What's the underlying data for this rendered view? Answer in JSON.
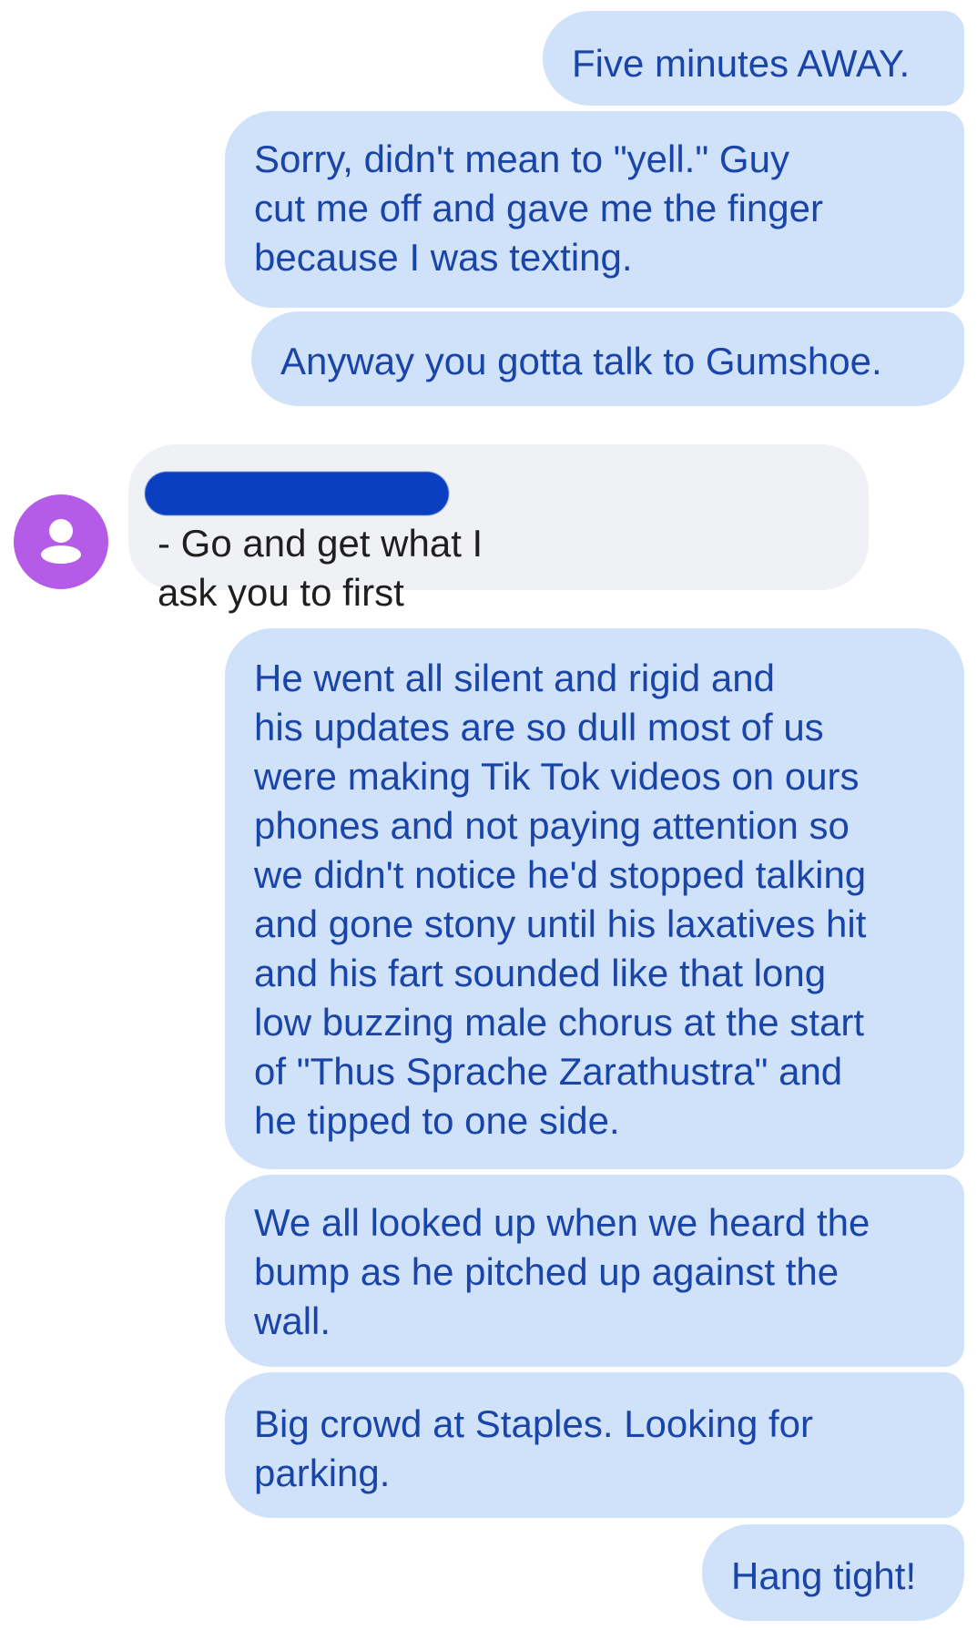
{
  "messages": [
    {
      "text": "Five minutes AWAY."
    },
    {
      "text": "Sorry, didn't mean to \"yell.\"  Guy\ncut me off and gave me the finger\nbecause I was texting."
    },
    {
      "text": "Anyway you gotta talk to Gumshoe."
    },
    {
      "text": "- Go and get what I\nask you to first"
    },
    {
      "text": "He went all silent and rigid and\nhis updates are so dull most of us\nwere making Tik Tok videos on ours\nphones and not paying attention so\nwe didn't notice he'd stopped talking\nand gone stony until his laxatives hit\nand his fart sounded like that long\nlow buzzing male chorus at the start\nof \"Thus Sprache Zarathustra\" and\nhe tipped to one side."
    },
    {
      "text": "We all looked up when we heard the\nbump as he pitched up against the\nwall."
    },
    {
      "text": "Big crowd at Staples.  Looking for\nparking."
    },
    {
      "text": "Hang tight!"
    }
  ],
  "colors": {
    "sent_bubble": "#d0e1fa",
    "sent_text": "#1a45a8",
    "received_bubble": "#f0f1f4",
    "received_text": "#1f1f1f",
    "avatar": "#b45be8",
    "redaction": "#0a3fbf"
  },
  "icons": {
    "avatar": "person-icon"
  }
}
